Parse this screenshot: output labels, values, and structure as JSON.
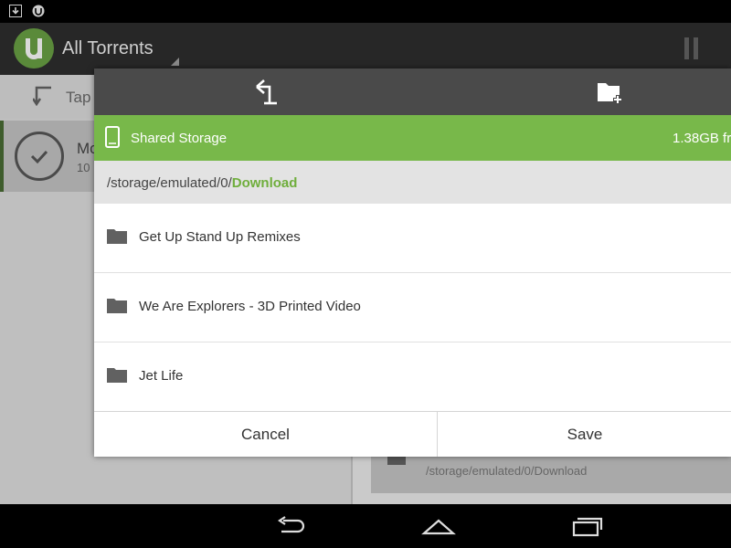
{
  "app": {
    "title": "All Torrents"
  },
  "background": {
    "tap_hint": "Tap",
    "item_title": "Mo",
    "item_sub": "10",
    "card_path": "/storage/emulated/0/Download"
  },
  "dialog": {
    "storage": {
      "name": "Shared Storage",
      "free": "1.38GB fr"
    },
    "path": {
      "prefix": "/storage/emulated/0/",
      "current": "Download"
    },
    "folders": [
      {
        "name": "Get Up Stand Up Remixes"
      },
      {
        "name": "We Are Explorers - 3D Printed Video"
      },
      {
        "name": "Jet Life"
      }
    ],
    "buttons": {
      "cancel": "Cancel",
      "save": "Save"
    }
  },
  "icons": {
    "up": "arrow-up-left-icon",
    "new_folder": "new-folder-icon",
    "phone": "phone-icon",
    "folder": "folder-icon",
    "pause": "pause-icon",
    "back": "back-icon",
    "home": "home-icon",
    "recents": "recents-icon"
  },
  "colors": {
    "accent_green": "#78b84a",
    "path_green": "#6fae3c",
    "toolbar": "#4a4a4a"
  }
}
